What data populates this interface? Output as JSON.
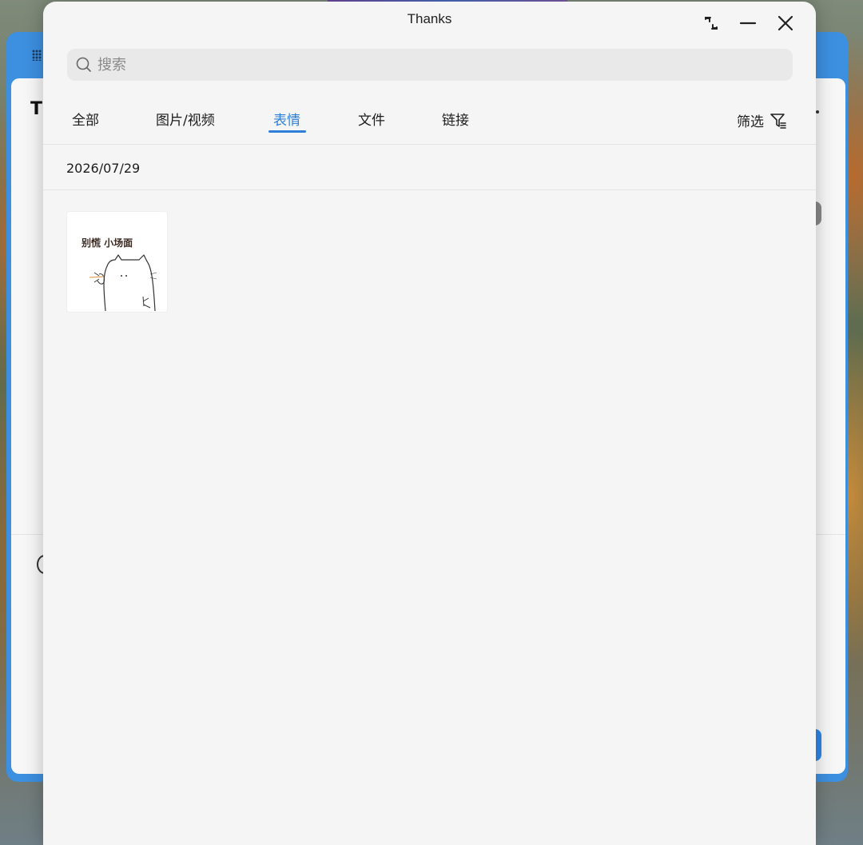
{
  "dialog": {
    "title": "Thanks"
  },
  "window_controls": {
    "restore_icon": "restore-icon",
    "minimize_icon": "minimize-icon",
    "close_icon": "close-icon"
  },
  "search": {
    "placeholder": "搜索",
    "value": ""
  },
  "tabs": [
    {
      "label": "全部",
      "active": false
    },
    {
      "label": "图片/视频",
      "active": false
    },
    {
      "label": "表情",
      "active": true
    },
    {
      "label": "文件",
      "active": false
    },
    {
      "label": "链接",
      "active": false
    }
  ],
  "filter": {
    "label": "筛选",
    "icon": "filter-icon"
  },
  "groups": [
    {
      "date": "2026/07/29",
      "items": [
        {
          "type": "sticker",
          "caption": "别慌  小场面"
        }
      ]
    }
  ],
  "background_window": {
    "title_initial": "T"
  },
  "colors": {
    "accent": "#2d7fd8",
    "frame": "#3d8fe0",
    "dialog_bg": "#f5f5f5"
  }
}
